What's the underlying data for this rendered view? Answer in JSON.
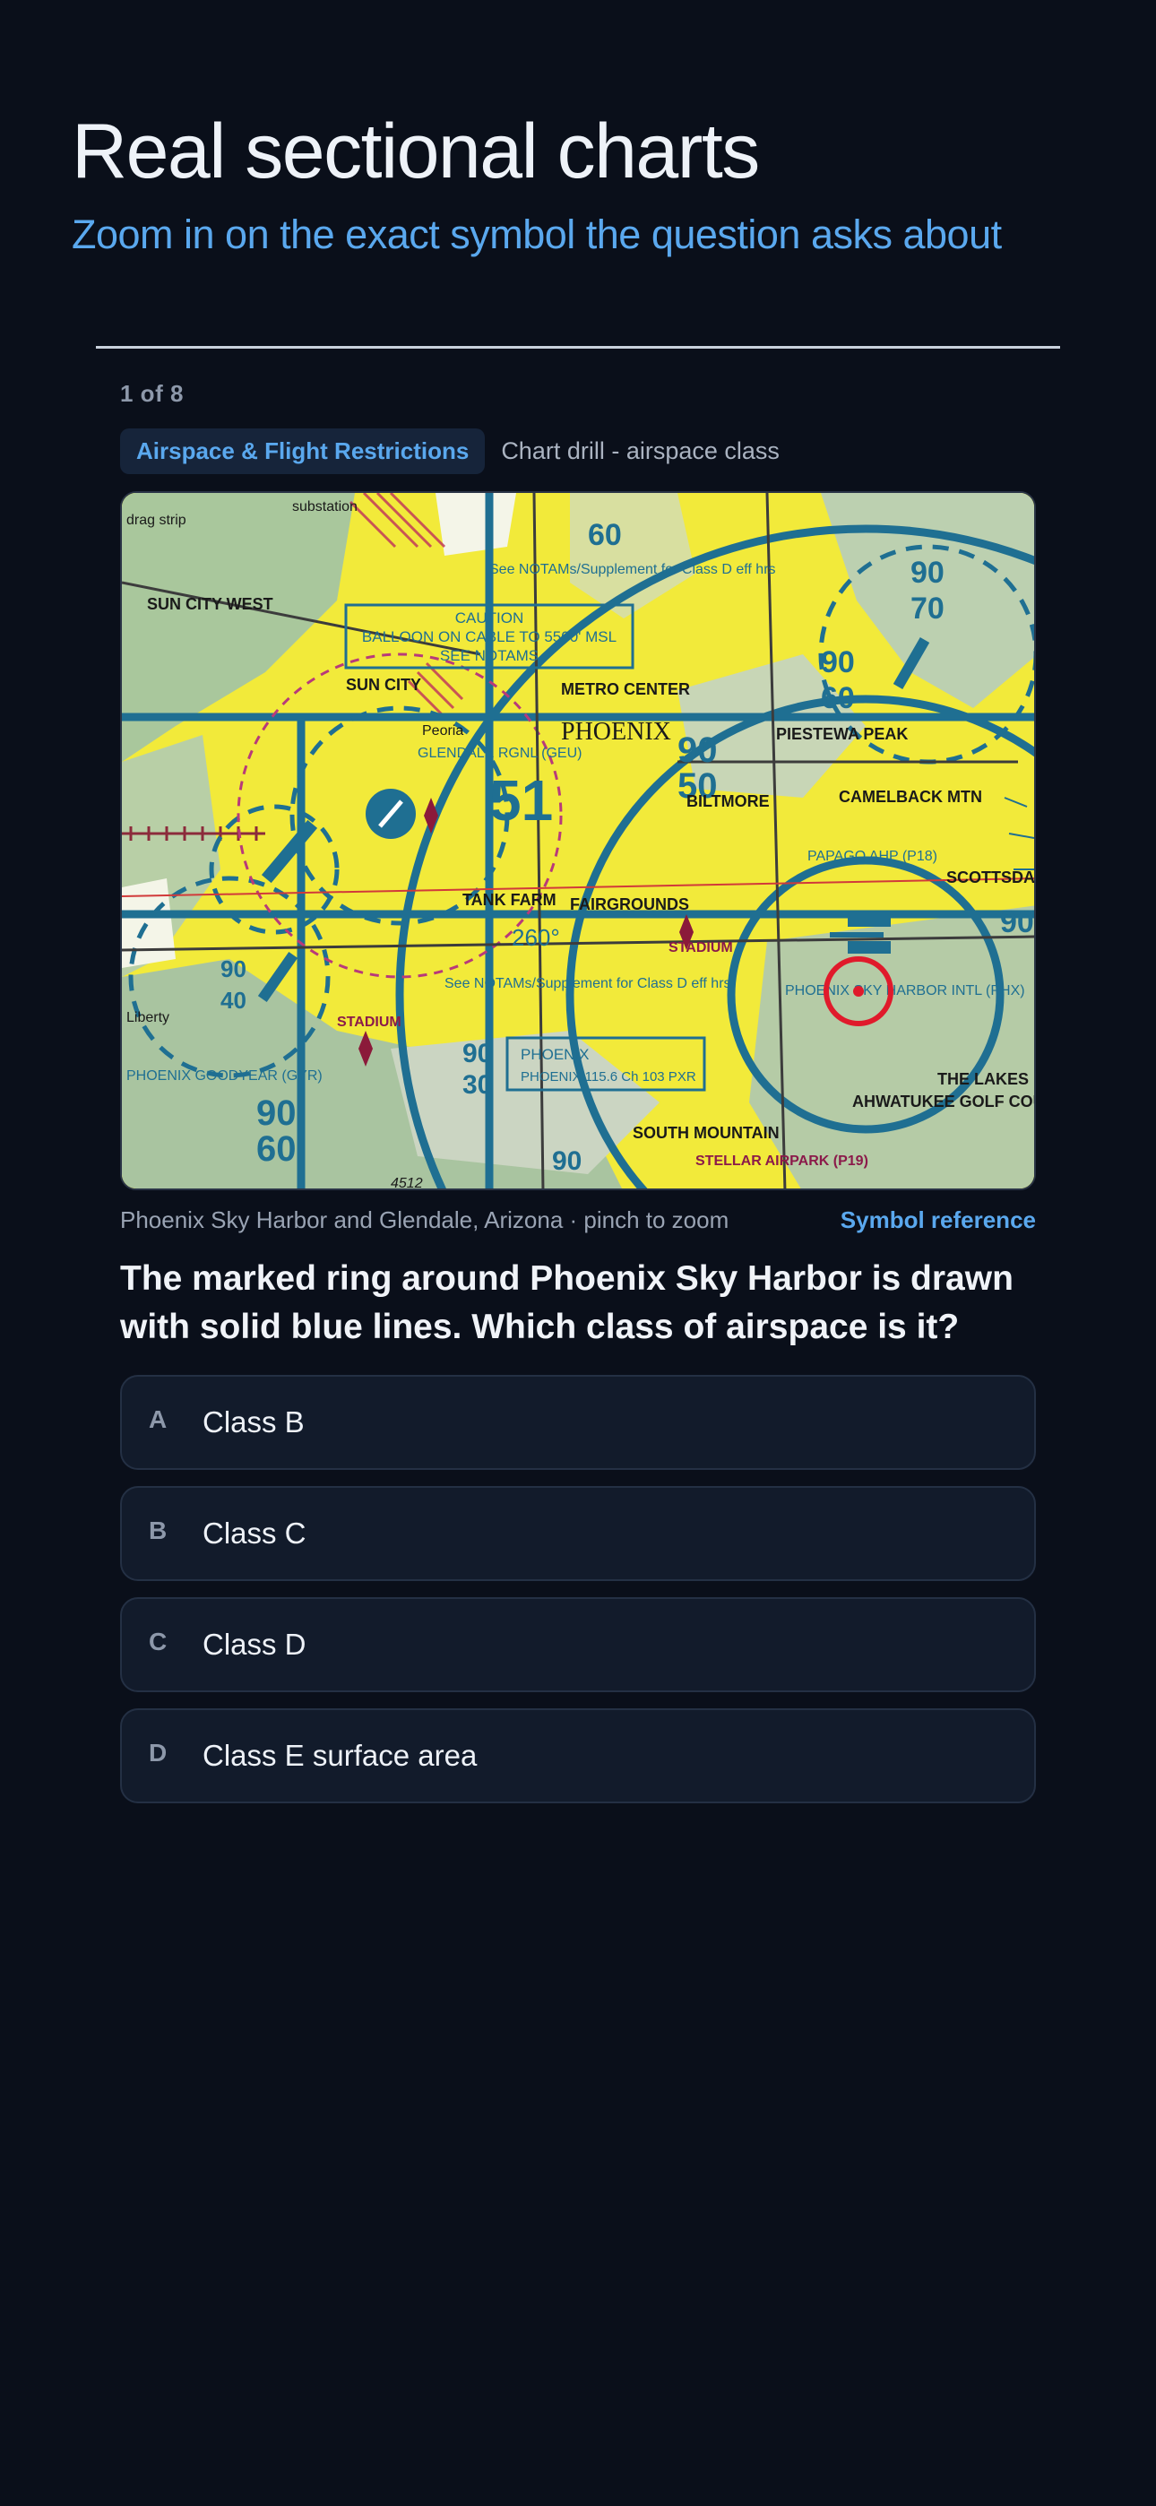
{
  "header": {
    "title": "Real sectional charts",
    "subtitle": "Zoom in on the exact symbol the question asks about"
  },
  "quiz": {
    "progress": "1 of 8",
    "category": "Airspace & Flight Restrictions",
    "drill_type": "Chart drill - airspace class",
    "chart_caption": "Phoenix Sky Harbor and Glendale, Arizona · pinch to zoom",
    "symbol_reference_label": "Symbol reference",
    "question": "The marked ring around Phoenix Sky Harbor is drawn with solid blue lines. Which class of airspace is it?",
    "options": [
      {
        "letter": "A",
        "text": "Class B"
      },
      {
        "letter": "B",
        "text": "Class C"
      },
      {
        "letter": "C",
        "text": "Class D"
      },
      {
        "letter": "D",
        "text": "Class E surface area"
      }
    ]
  },
  "chart_labels": {
    "phoenix": "PHOENIX",
    "metro_center": "METRO CENTER",
    "piestewa_peak": "PIESTEWA PEAK",
    "camelback": "CAMELBACK MTN",
    "scottsdale": "SCOTTSDALE",
    "biltmore": "BILTMORE",
    "fairgrounds": "FAIRGROUNDS",
    "tank_farm": "TANK FARM",
    "sun_city_west": "SUN CITY WEST",
    "sun_city": "SUN CITY",
    "peoria": "Peoria",
    "glendale_rgnl": "GLENDALE RGNL (GEU)",
    "caution": "CAUTION",
    "balloon": "BALLOON ON CABLE TO 5500' MSL",
    "see_notams": "SEE NOTAMS",
    "papago": "PAPAGO AHP (P18)",
    "sky_harbor": "PHOENIX SKY HARBOR INTL (PHX)",
    "ahwatukee": "AHWATUKEE GOLF COURSE",
    "south_mountain": "SOUTH MOUNTAIN",
    "stellar": "STELLAR AIRPARK (P19)",
    "the_lakes": "THE LAKES",
    "liberty": "Liberty",
    "goodyear": "PHOENIX GOODYEAR (GYR)",
    "stadium": "STADIUM",
    "substation": "substation",
    "drag_strip": "drag strip",
    "mfa_51": "51",
    "mfa_90": "90",
    "mfa_60": "60",
    "mfa_50": "50",
    "mfa_30": "30",
    "mfa_40": "40",
    "mfa_70": "70",
    "elev_4512": "4512",
    "course_260": "260°",
    "see_notams_supp": "See NOTAMs/Supplement for Class D eff hrs",
    "phoenix_vor": "PHOENIX 115.6 Ch 103 PXR"
  },
  "colors": {
    "background": "#0a0f1a",
    "accent": "#5aa8ee",
    "chart_yellow": "#f2ea3a",
    "class_b_blue": "#1f6f92",
    "marker_red": "#e01a2b"
  }
}
